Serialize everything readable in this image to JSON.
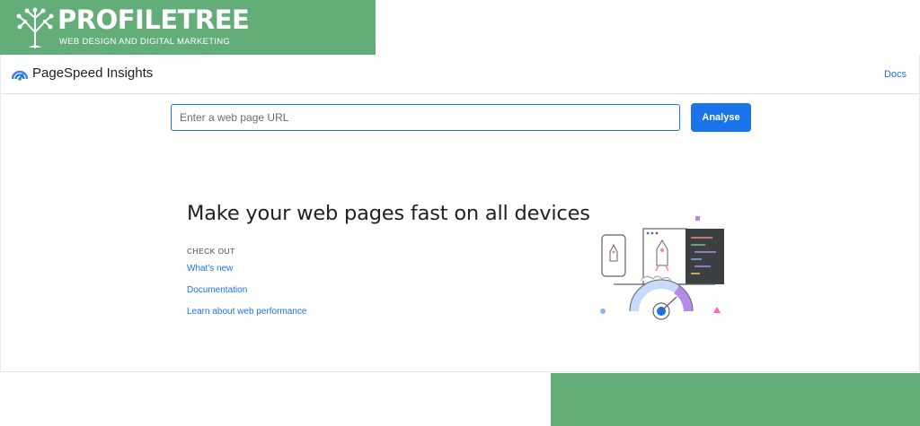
{
  "brand": {
    "name": "PROFILETREE",
    "tagline": "WEB DESIGN AND DIGITAL MARKETING"
  },
  "header": {
    "logo_icon": "pagespeed-gauge-icon",
    "title": "PageSpeed Insights",
    "docs_label": "Docs"
  },
  "search": {
    "placeholder": "Enter a web page URL",
    "value": "",
    "button_label": "Analyse"
  },
  "hero": {
    "heading": "Make your web pages fast on all devices",
    "check_out_label": "CHECK OUT",
    "links": [
      {
        "label": "What's new"
      },
      {
        "label": "Documentation"
      },
      {
        "label": "Learn about web performance"
      }
    ]
  },
  "colors": {
    "brand_green": "#63ad78",
    "accent_blue": "#1a73e8",
    "text_dark": "#202124"
  }
}
